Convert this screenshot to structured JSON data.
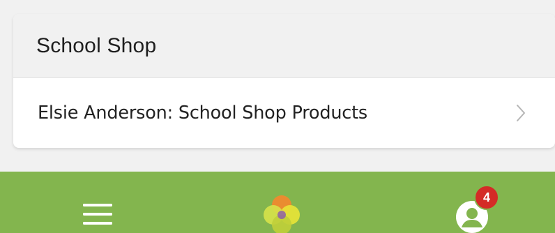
{
  "colors": {
    "page_background": "#f1f1f1",
    "card_header_background": "#f1f1f1",
    "card_background": "#ffffff",
    "tabbar_background": "#83b54e",
    "badge_color": "#d42b26",
    "chevron_color": "#b5b5b5"
  },
  "card": {
    "title": "School Shop",
    "rows": [
      {
        "label": "Elsie Anderson: School Shop Products",
        "icon": "chevron-right-icon"
      }
    ]
  },
  "tabbar": {
    "items": [
      {
        "name": "menu",
        "icon": "hamburger-menu-icon"
      },
      {
        "name": "home",
        "icon": "app-logo-icon"
      },
      {
        "name": "profile",
        "icon": "user-profile-icon",
        "badge": "4"
      }
    ]
  }
}
